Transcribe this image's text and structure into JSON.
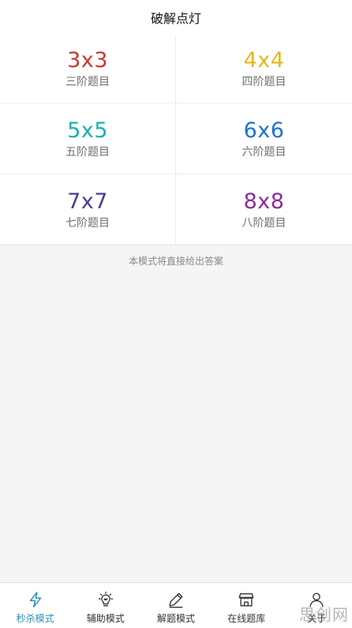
{
  "header": {
    "title": "破解点灯"
  },
  "levels": [
    {
      "size": "3x3",
      "label": "三阶题目",
      "color": "#c9392f"
    },
    {
      "size": "4x4",
      "label": "四阶题目",
      "color": "#e8b71c"
    },
    {
      "size": "5x5",
      "label": "五阶题目",
      "color": "#1cb1a9"
    },
    {
      "size": "6x6",
      "label": "六阶题目",
      "color": "#1a73d1"
    },
    {
      "size": "7x7",
      "label": "七阶题目",
      "color": "#4f3a96"
    },
    {
      "size": "8x8",
      "label": "八阶题目",
      "color": "#8e2a9c"
    }
  ],
  "hint": "本模式将直接给出答案",
  "tabs": [
    {
      "label": "秒杀模式",
      "icon": "lightning-icon",
      "active": true
    },
    {
      "label": "辅助模式",
      "icon": "lightbulb-icon",
      "active": false
    },
    {
      "label": "解题模式",
      "icon": "pencil-icon",
      "active": false
    },
    {
      "label": "在线题库",
      "icon": "store-icon",
      "active": false
    },
    {
      "label": "关于",
      "icon": "user-icon",
      "active": false
    }
  ],
  "colors": {
    "accent": "#2a8fb7",
    "inactive": "#333333"
  },
  "watermark": "思创网"
}
